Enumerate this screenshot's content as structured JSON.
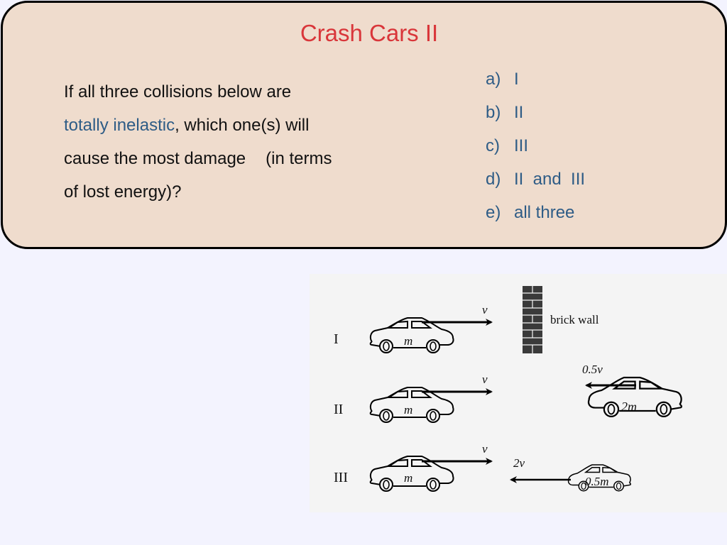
{
  "slide": {
    "title": "Crash Cars II",
    "question": {
      "line1": "If all three collisions below are",
      "highlight": "totally inelastic",
      "line2_rest": ", which one(s) will",
      "line3_a": "cause the most damage",
      "line3_b": "(in terms",
      "line4": "of lost energy)?"
    },
    "options": [
      {
        "letter": "a)",
        "text": "I"
      },
      {
        "letter": "b)",
        "text": "II"
      },
      {
        "letter": "c)",
        "text": "III"
      },
      {
        "letter": "d)",
        "text": "II  and  III"
      },
      {
        "letter": "e)",
        "text": "all three"
      }
    ]
  },
  "colors": {
    "title": "#d9363a",
    "highlight": "#2e5c86",
    "options": "#2e5c86",
    "panel_bg": "#efdccd",
    "page_bg": "#f3f3fe",
    "figure_bg": "#f4f4f4"
  },
  "figure": {
    "scenarios": [
      {
        "label": "I",
        "car_mass": "m",
        "car_velocity": "v",
        "target": "brick wall"
      },
      {
        "label": "II",
        "car_mass": "m",
        "car_velocity": "v",
        "other_mass": "2m",
        "other_velocity": "0.5v"
      },
      {
        "label": "III",
        "car_mass": "m",
        "car_velocity": "v",
        "other_mass": "0.5m",
        "other_velocity": "2v"
      }
    ],
    "wall_label": "brick wall"
  }
}
